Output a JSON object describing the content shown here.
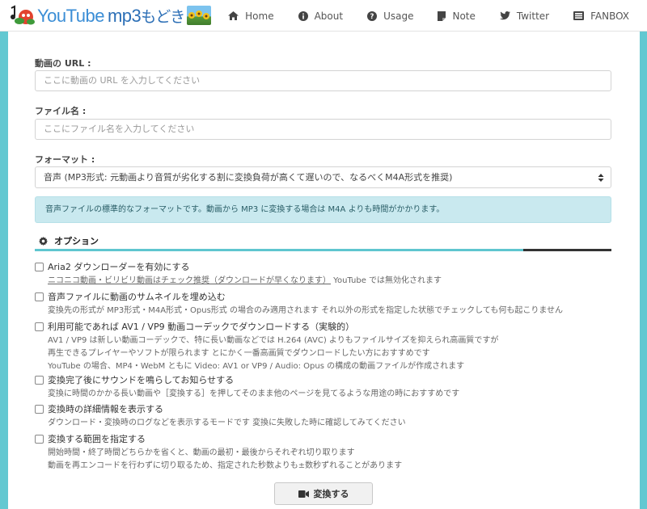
{
  "brand": {
    "part1": "YouTube",
    "part2": "mp3",
    "part3": "もどき"
  },
  "nav": [
    {
      "label": "Home",
      "icon": "home-icon"
    },
    {
      "label": "About",
      "icon": "info-circle-icon"
    },
    {
      "label": "Usage",
      "icon": "question-circle-icon"
    },
    {
      "label": "Note",
      "icon": "note-icon"
    },
    {
      "label": "Twitter",
      "icon": "twitter-icon"
    },
    {
      "label": "FANBOX",
      "icon": "fanbox-icon"
    }
  ],
  "form": {
    "url_label": "動画の URL :",
    "url_placeholder": "ここに動画の URL を入力してください",
    "filename_label": "ファイル名 :",
    "filename_placeholder": "ここにファイル名を入力してください",
    "format_label": "フォーマット :",
    "format_selected": "音声 (MP3形式: 元動画より音質が劣化する割に変換負荷が高くて遅いので、なるべくM4A形式を推奨)",
    "info_text": "音声ファイルの標準的なフォーマットです。動画から MP3 に変換する場合は M4A よりも時間がかかります。"
  },
  "options": {
    "header": "オプション",
    "items": [
      {
        "title": "Aria2 ダウンローダーを有効にする",
        "desc_link": "ニコニコ動画・ビリビリ動画はチェック推奨（ダウンロードが早くなります）",
        "desc": " YouTube では無効化されます"
      },
      {
        "title": "音声ファイルに動画のサムネイルを埋め込む",
        "desc": "変換先の形式が MP3形式・M4A形式・Opus形式 の場合のみ適用されます それ以外の形式を指定した状態でチェックしても何も起こりません"
      },
      {
        "title": "利用可能であれば AV1 / VP9 動画コーデックでダウンロードする（実験的）",
        "desc1": "AV1 / VP9 は新しい動画コーデックで、特に長い動画などでは H.264 (AVC) よりもファイルサイズを抑えられ高画質ですが",
        "desc2": "再生できるプレイヤーやソフトが限られます とにかく一番高画質でダウンロードしたい方におすすめです",
        "desc3": "YouTube の場合、MP4・WebM ともに Video: AV1 or VP9 / Audio: Opus の構成の動画ファイルが作成されます"
      },
      {
        "title": "変換完了後にサウンドを鳴らしてお知らせする",
        "desc": "変換に時間のかかる長い動画や［変換する］を押してそのまま他のページを見てるような用途の時におすすめです"
      },
      {
        "title": "変換時の詳細情報を表示する",
        "desc": "ダウンロード・変換時のログなどを表示するモードです 変換に失敗した時に確認してみてください"
      },
      {
        "title": "変換する範囲を指定する",
        "desc1": "開始時間・終了時間どちらかを省くと、動画の最初・最後からそれぞれ切り取ります",
        "desc2": "動画を再エンコードを行わずに切り取るため、指定された秒数よりも±数秒ずれることがあります"
      }
    ]
  },
  "convert_button": "変換する",
  "colors": {
    "background": "#63c8d1",
    "accent": "#5fc6cf",
    "info_bg": "#c9e9ef"
  }
}
